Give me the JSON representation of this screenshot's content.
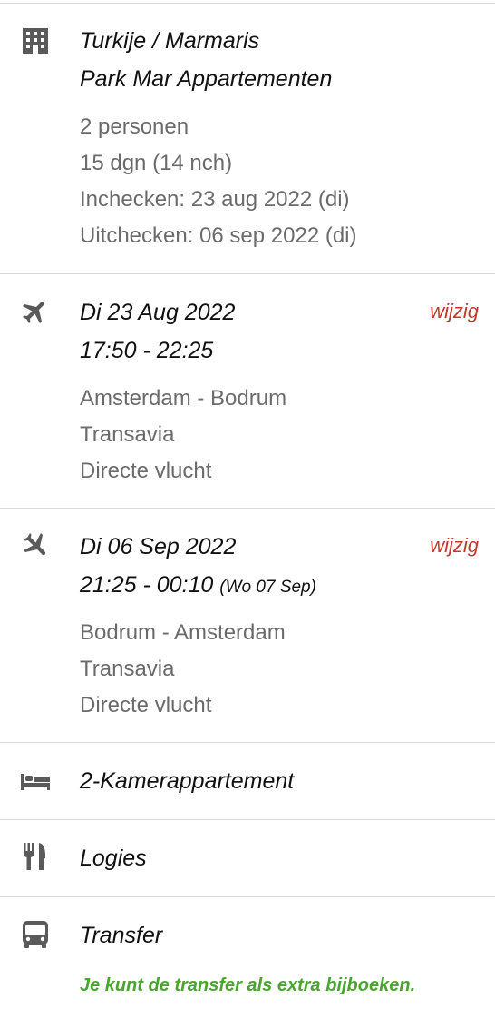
{
  "colors": {
    "accent_change": "#c0392b",
    "accent_note": "#4aa52e",
    "text_muted": "#6b6b6b",
    "divider": "#d9d9d9"
  },
  "accommodation": {
    "icon": "building-icon",
    "location": "Turkije / Marmaris",
    "name": "Park Mar Appartementen",
    "details": [
      "2 personen",
      "15 dgn (14 nch)",
      "Inchecken: 23 aug 2022 (di)",
      "Uitchecken: 06 sep 2022 (di)"
    ]
  },
  "outbound_flight": {
    "icon": "plane-departure-icon",
    "date": "Di 23 Aug 2022",
    "times": "17:50 - 22:25",
    "change_label": "wijzig",
    "details": [
      "Amsterdam - Bodrum",
      "Transavia",
      "Directe vlucht"
    ]
  },
  "return_flight": {
    "icon": "plane-arrival-icon",
    "date": "Di 06 Sep 2022",
    "times": "21:25 - 00:10",
    "arrival_note": "(Wo 07 Sep)",
    "change_label": "wijzig",
    "details": [
      "Bodrum - Amsterdam",
      "Transavia",
      "Directe vlucht"
    ]
  },
  "room": {
    "icon": "bed-icon",
    "label": "2-Kamerappartement"
  },
  "board": {
    "icon": "cutlery-icon",
    "label": "Logies"
  },
  "transfer": {
    "icon": "bus-icon",
    "label": "Transfer",
    "note": "Je kunt de transfer als extra bijboeken."
  }
}
